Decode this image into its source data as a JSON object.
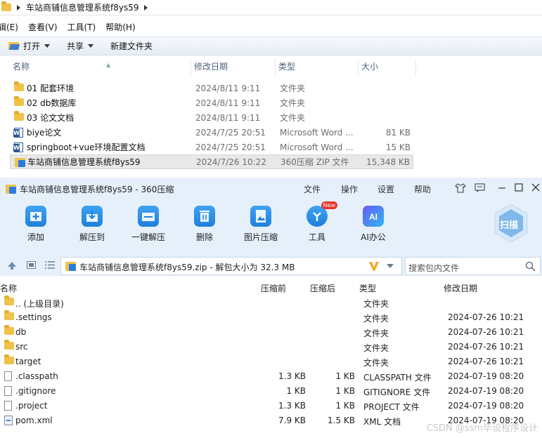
{
  "explorer": {
    "breadcrumb": "车站商铺信息管理系统f8ys59",
    "menu": [
      "辑(E)",
      "查看(V)",
      "工具(T)",
      "帮助(H)"
    ],
    "toolbar": {
      "open": "打开",
      "share": "共享",
      "new_folder": "新建文件夹"
    },
    "columns": [
      "名称",
      "修改日期",
      "类型",
      "大小"
    ],
    "files": [
      {
        "name": "01 配套环境",
        "date": "2024/8/11 9:11",
        "type": "文件夹",
        "size": "",
        "icon": "folder-icon"
      },
      {
        "name": "02 db数据库",
        "date": "2024/8/11 9:11",
        "type": "文件夹",
        "size": "",
        "icon": "folder-icon"
      },
      {
        "name": "03 论文文档",
        "date": "2024/8/11 9:11",
        "type": "文件夹",
        "size": "",
        "icon": "folder-icon"
      },
      {
        "name": "biye论文",
        "date": "2024/7/25 20:51",
        "type": "Microsoft Word ...",
        "size": "81 KB",
        "icon": "word-icon"
      },
      {
        "name": "springboot+vue环境配置文档",
        "date": "2024/7/25 20:51",
        "type": "Microsoft Word ...",
        "size": "15 KB",
        "icon": "word-icon"
      },
      {
        "name": "车站商铺信息管理系统f8ys59",
        "date": "2024/7/26 10:22",
        "type": "360压缩 ZIP 文件",
        "size": "15,348 KB",
        "icon": "zip-icon"
      }
    ]
  },
  "zip": {
    "title": "车站商铺信息管理系统f8ys59 - 360压缩",
    "menu": [
      "文件",
      "操作",
      "设置",
      "帮助"
    ],
    "tools": [
      "添加",
      "解压到",
      "一键解压",
      "删除",
      "图片压缩",
      "工具",
      "AI办公"
    ],
    "new_badge": "New",
    "scan": "扫描",
    "path": "车站商铺信息管理系统f8ys59.zip - 解包大小为 32.3 MB",
    "search_placeholder": "搜索包内文件",
    "columns": [
      "名称",
      "压缩前",
      "压缩后",
      "类型",
      "修改日期"
    ],
    "entries": [
      {
        "name": ".. (上级目录)",
        "before": "",
        "after": "",
        "type": "文件夹",
        "date": "",
        "icon": "folder-icon"
      },
      {
        "name": ".settings",
        "before": "",
        "after": "",
        "type": "文件夹",
        "date": "2024-07-26 10:21",
        "icon": "folder-icon"
      },
      {
        "name": "db",
        "before": "",
        "after": "",
        "type": "文件夹",
        "date": "2024-07-26 10:21",
        "icon": "folder-icon"
      },
      {
        "name": "src",
        "before": "",
        "after": "",
        "type": "文件夹",
        "date": "2024-07-26 10:21",
        "icon": "folder-icon"
      },
      {
        "name": "target",
        "before": "",
        "after": "",
        "type": "文件夹",
        "date": "2024-07-26 10:21",
        "icon": "folder-icon"
      },
      {
        "name": ".classpath",
        "before": "1.3 KB",
        "after": "1 KB",
        "type": "CLASSPATH 文件",
        "date": "2024-07-19 08:20",
        "icon": "file-icon"
      },
      {
        "name": ".gitignore",
        "before": "1 KB",
        "after": "1 KB",
        "type": "GITIGNORE 文件",
        "date": "2024-07-19 08:20",
        "icon": "file-icon"
      },
      {
        "name": ".project",
        "before": "1.3 KB",
        "after": "1 KB",
        "type": "PROJECT 文件",
        "date": "2024-07-19 08:20",
        "icon": "file-icon"
      },
      {
        "name": "pom.xml",
        "before": "7.9 KB",
        "after": "1.5 KB",
        "type": "XML 文档",
        "date": "2024-07-19 08:20",
        "icon": "xml-icon"
      }
    ]
  },
  "watermark": "CSDN @ssm毕设程序设计"
}
